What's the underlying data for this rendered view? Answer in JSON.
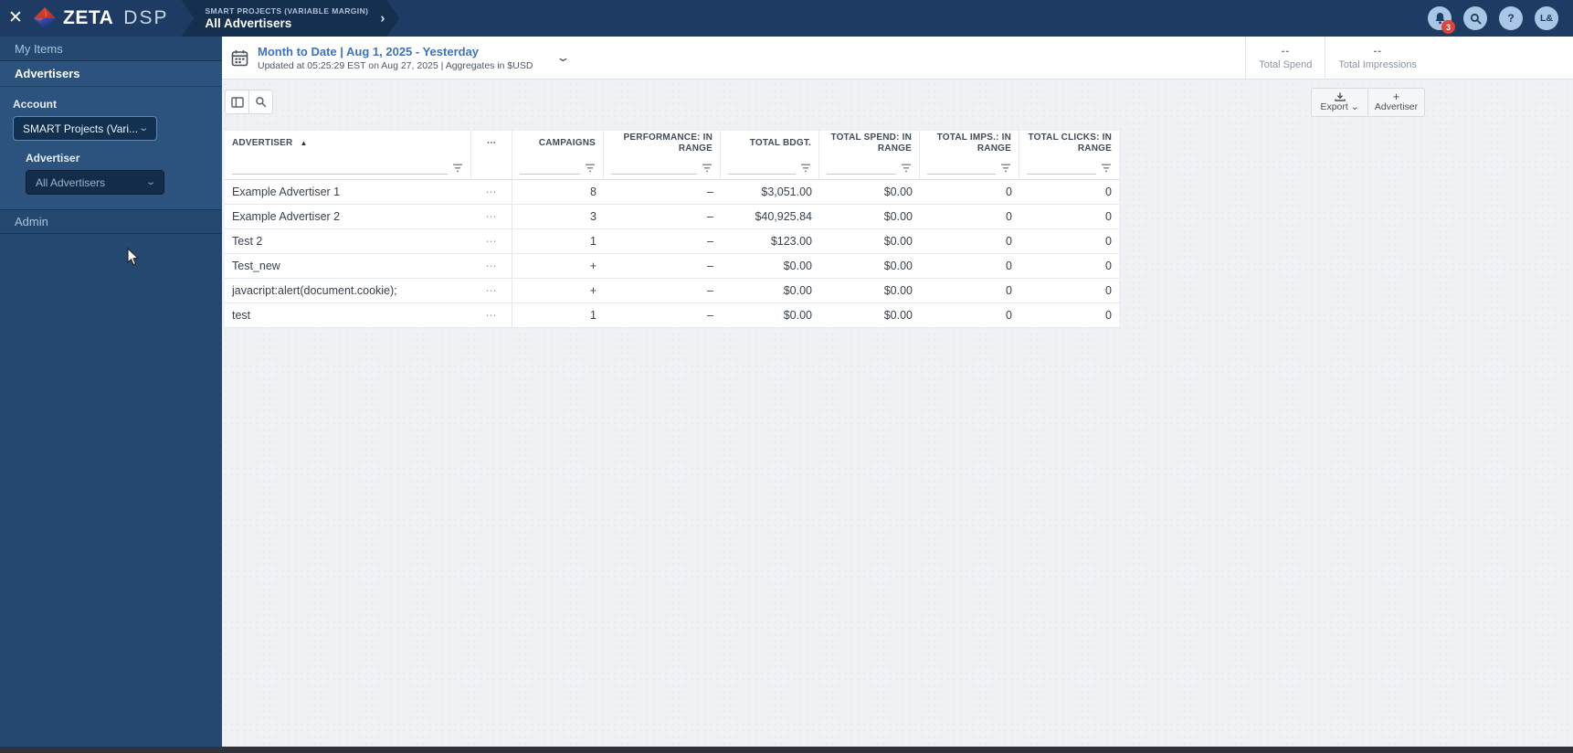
{
  "topbar": {
    "close_glyph": "✕",
    "brand_zeta": "ZETA",
    "brand_dsp": "DSP",
    "breadcrumb_account": "SMART PROJECTS (VARIABLE MARGIN)",
    "breadcrumb_page": "All Advertisers",
    "breadcrumb_chevron": "›",
    "notification_count": "3",
    "help_glyph": "?",
    "avatar_initials": "L&"
  },
  "sidebar": {
    "my_items_label": "My Items",
    "advertisers_label": "Advertisers",
    "account_label": "Account",
    "account_value": "SMART Projects (Vari...",
    "advertiser_label": "Advertiser",
    "advertiser_value": "All Advertisers",
    "admin_label": "Admin",
    "dropdown_chevron": "⌄"
  },
  "datebar": {
    "title": "Month to Date | Aug 1, 2025 - Yesterday",
    "subtitle": "Updated at 05:25:29 EST on Aug 27, 2025 | Aggregates in $USD",
    "chevron": "⌄",
    "stats": [
      {
        "value": "--",
        "label": "Total Spend"
      },
      {
        "value": "--",
        "label": "Total Impressions"
      }
    ]
  },
  "toolbar": {
    "export_label": "Export ⌄",
    "add_glyph": "+",
    "add_advertiser_label": "Advertiser"
  },
  "table": {
    "columns": [
      "ADVERTISER",
      "⋯",
      "CAMPAIGNS",
      "PERFORMANCE: IN RANGE",
      "TOTAL BDGT.",
      "TOTAL SPEND: IN RANGE",
      "TOTAL IMPS.: IN RANGE",
      "TOTAL CLICKS: IN RANGE"
    ],
    "sort_glyph": "▲",
    "row_actions_glyph": "⋯",
    "rows": [
      {
        "advertiser": "Example Advertiser 1",
        "campaigns": "8",
        "performance": "–",
        "total_budget": "$3,051.00",
        "total_spend": "$0.00",
        "total_imps": "0",
        "total_clicks": "0"
      },
      {
        "advertiser": "Example Advertiser 2",
        "campaigns": "3",
        "performance": "–",
        "total_budget": "$40,925.84",
        "total_spend": "$0.00",
        "total_imps": "0",
        "total_clicks": "0"
      },
      {
        "advertiser": "Test 2",
        "campaigns": "1",
        "performance": "–",
        "total_budget": "$123.00",
        "total_spend": "$0.00",
        "total_imps": "0",
        "total_clicks": "0"
      },
      {
        "advertiser": "Test_new",
        "campaigns": "+",
        "performance": "–",
        "total_budget": "$0.00",
        "total_spend": "$0.00",
        "total_imps": "0",
        "total_clicks": "0"
      },
      {
        "advertiser": "javacript:alert(document.cookie);",
        "campaigns": "+",
        "performance": "–",
        "total_budget": "$0.00",
        "total_spend": "$0.00",
        "total_imps": "0",
        "total_clicks": "0"
      },
      {
        "advertiser": "test",
        "campaigns": "1",
        "performance": "–",
        "total_budget": "$0.00",
        "total_spend": "$0.00",
        "total_imps": "0",
        "total_clicks": "0"
      }
    ]
  },
  "colors": {
    "topbar_navy": "#1E3C63",
    "sidebar_navy": "#24486F",
    "accent_blue": "#3F72B8",
    "badge_red": "#D9453C",
    "icon_circle_blue": "#AAC6E6"
  }
}
